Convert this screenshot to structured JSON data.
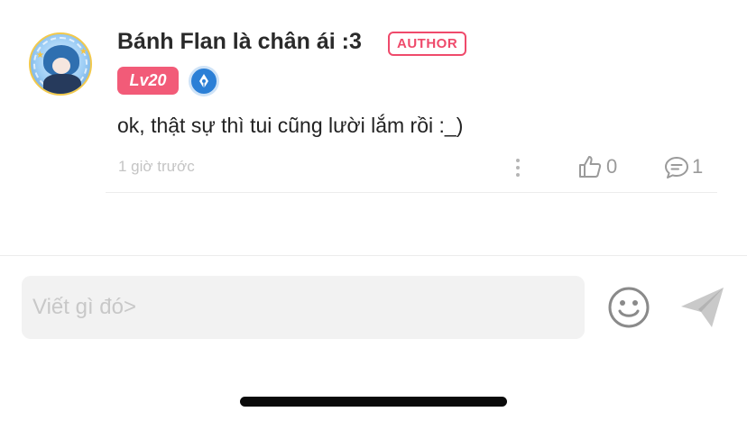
{
  "comment": {
    "author_name": "Bánh Flan là chân ái :3",
    "author_badge": "AUTHOR",
    "level_badge": "Lv20",
    "text": "ok, thật sự thì tui cũng lười lắm rồi :_)",
    "timestamp": "1 giờ trước",
    "like_count": "0",
    "reply_count": "1"
  },
  "composer": {
    "placeholder": "Viết gì đó>"
  },
  "icons": {
    "avatar": "user-avatar",
    "pen_badge": "pen-nib-icon",
    "more": "more-vertical-icon",
    "like": "thumbs-up-icon",
    "reply": "comment-bubble-icon",
    "emoji": "smiley-icon",
    "send": "send-icon"
  },
  "colors": {
    "accent_pink": "#ef4a6b",
    "level_pink": "#f25b78",
    "pen_blue": "#2b7fd6",
    "muted_gray": "#9a9a9a"
  }
}
